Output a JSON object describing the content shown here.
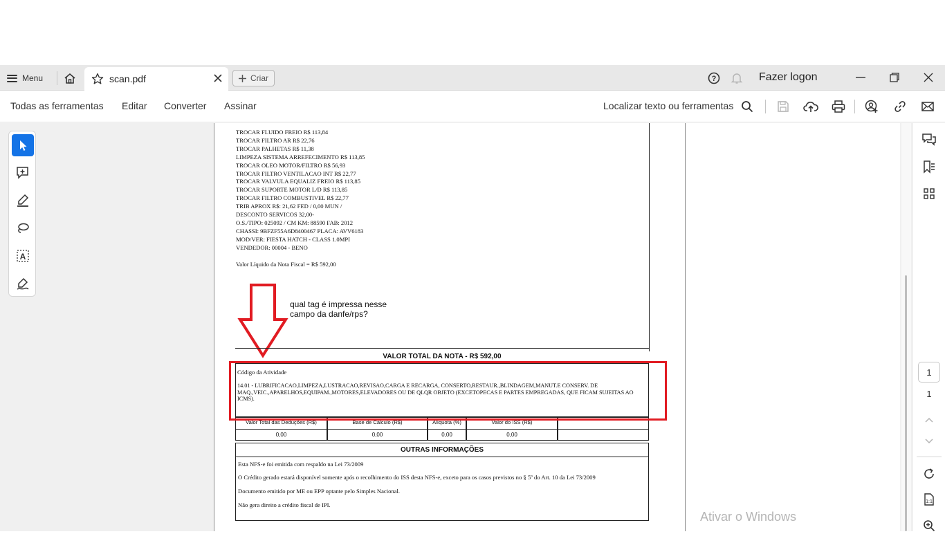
{
  "titlebar": {
    "menu_label": "Menu",
    "tab_title": "scan.pdf",
    "create_label": "Criar",
    "logon_label": "Fazer logon"
  },
  "toolbar": {
    "items": [
      "Todas as ferramentas",
      "Editar",
      "Converter",
      "Assinar"
    ],
    "find_label": "Localizar texto ou ferramentas"
  },
  "navigation": {
    "page_current": "1",
    "page_total": "1"
  },
  "document": {
    "service_lines": [
      "TROCAR FLUIDO FREIO R$ 113,84",
      "TROCAR FILTRO AR R$ 22,76",
      "TROCAR PALHETAS R$ 11,38",
      "LIMPEZA SISTEMA ARREFECIMENTO R$ 113,85",
      "TROCAR OLEO MOTOR/FILTRO R$ 56,93",
      "TROCAR FILTRO VENTILACAO INT R$ 22,77",
      "TROCAR VALVULA EQUALIZ FREIO R$ 113,85",
      "TROCAR SUPORTE MOTOR L/D R$ 113,85",
      "TROCAR FILTRO COMBUSTIVEL R$ 22,77",
      "TRIB APROX R$: 21,62 FED / 0,00 MUN /",
      "DESCONTO SERVICOS 32,00-",
      "O.S./TIPO: 025092 / CM KM: 88590 FAB: 2012",
      "CHASSI: 9BFZF55A6D8400467 PLACA: AVV6183",
      "MOD/VER: FIESTA HATCH - CLASS 1.0MPI",
      "VENDEDOR: 00004 - BENO"
    ],
    "valor_liquido": "Valor Líquido da Nota Fiscal = R$ 592,00",
    "valor_total": "VALOR TOTAL DA NOTA - R$ 592,00",
    "codigo_title": "Código da Atividade",
    "codigo_text": "14.01 - LUBRIFICACAO,LIMPEZA,LUSTRACAO,REVISAO,CARGA E RECARGA, CONSERTO,RESTAUR.,BLINDAGEM,MANUT.E CONSERV. DE MAQ.,VEIC.,APARELHOS,EQUIPAM.,MOTORES,ELEVADORES OU DE QLQR OBJETO (EXCETOPECAS E PARTES EMPREGADAS, QUE FICAM SUJEITAS AO ICMS).",
    "table_headers": [
      "Valor Total das Deduções (R$)",
      "Base de Cálculo (R$)",
      "Alíquota (%)",
      "Valor do ISS (R$)",
      ""
    ],
    "table_values": [
      "0,00",
      "0,00",
      "0,00",
      "0,00",
      ""
    ],
    "outras_title": "OUTRAS INFORMAÇÕES",
    "info_lines": [
      "Esta NFS-e foi emitida com respaldo na Lei 73/2009",
      "O Crédito gerado estará disponível somente após o recolhimento do ISS desta NFS-e, exceto para os casos previstos no § 5º do Art. 10 da Lei 73/2009",
      "Documento emitido por ME ou EPP optante pelo Simples Nacional.",
      "Não gera direito a crédito fiscal de IPI."
    ],
    "annotation_question_line1": "qual tag é impressa nesse",
    "annotation_question_line2": "campo da danfe/rps?"
  },
  "watermark": "Ativar o Windows",
  "colors": {
    "accent": "#1473e6",
    "annotation_red": "#e11b22",
    "tabbar_bg": "#e8e8e8",
    "workspace_bg": "#f0f0f0"
  }
}
